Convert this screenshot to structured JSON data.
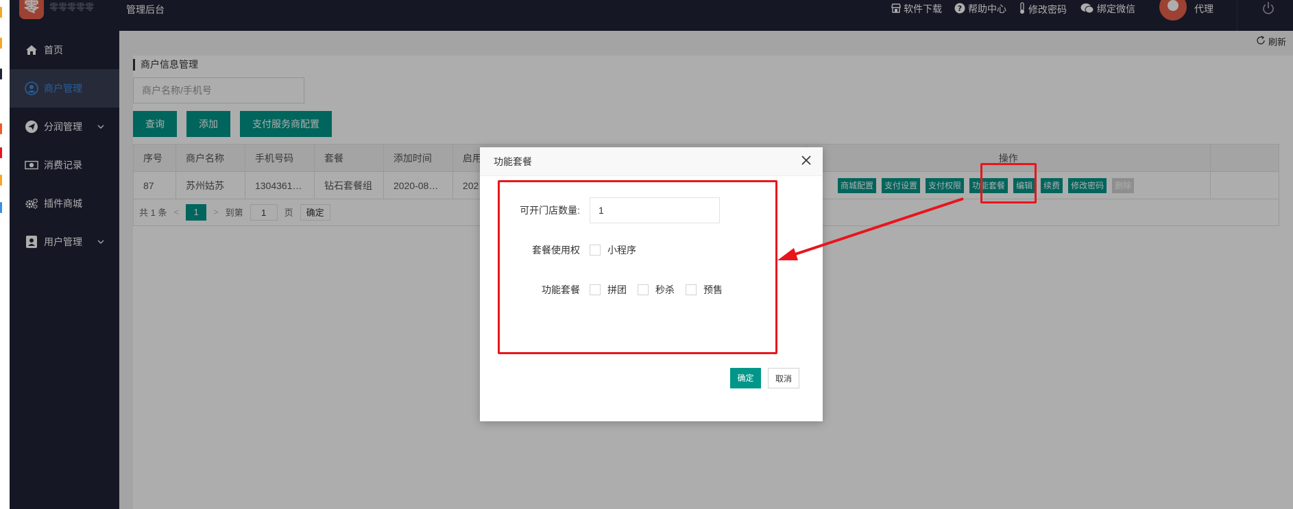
{
  "header": {
    "logo_char": "零",
    "logo_text": "零零零零零",
    "admin_title": "管理后台",
    "nav": [
      {
        "icon": "store-icon",
        "label": "软件下载"
      },
      {
        "icon": "help-icon",
        "label": "帮助中心"
      },
      {
        "icon": "thermometer-icon",
        "label": "修改密码"
      },
      {
        "icon": "wechat-icon",
        "label": "绑定微信"
      }
    ],
    "user_name": "代理"
  },
  "sidebar": {
    "items": [
      {
        "label": "首页",
        "icon": "home-icon",
        "active": false,
        "expandable": false
      },
      {
        "label": "商户管理",
        "icon": "user-circle-icon",
        "active": true,
        "expandable": false
      },
      {
        "label": "分润管理",
        "icon": "send-icon",
        "active": false,
        "expandable": true
      },
      {
        "label": "消费记录",
        "icon": "money-icon",
        "active": false,
        "expandable": false
      },
      {
        "label": "插件商城",
        "icon": "gears-icon",
        "active": false,
        "expandable": false
      },
      {
        "label": "用户管理",
        "icon": "user-card-icon",
        "active": false,
        "expandable": true
      }
    ]
  },
  "main": {
    "refresh_label": "刷新",
    "section_title": "商户信息管理",
    "search_placeholder": "商户名称/手机号",
    "buttons": {
      "query": "查询",
      "add": "添加",
      "pay_config": "支付服务商配置"
    },
    "table": {
      "headers": [
        "序号",
        "商户名称",
        "手机号码",
        "套餐",
        "添加时间",
        "启用",
        "操作"
      ],
      "rows": [
        {
          "id": "87",
          "name": "苏州姑苏",
          "phone": "1304361…",
          "package": "钻石套餐组",
          "added": "2020-08…",
          "enabled": "202"
        }
      ],
      "row_actions": [
        "商城配置",
        "支付设置",
        "支付权限",
        "功能套餐",
        "编辑",
        "续费",
        "修改密码",
        "删除"
      ]
    },
    "pager": {
      "total": "共 1 条",
      "prev": "<",
      "current": "1",
      "next": ">",
      "goto_label": "到第",
      "goto_value": "1",
      "page_unit": "页",
      "confirm": "确定"
    }
  },
  "modal": {
    "title": "功能套餐",
    "store_count_label": "可开门店数量:",
    "store_count_value": "1",
    "usage_label": "套餐使用权",
    "usage_options": [
      "小程序"
    ],
    "features_label": "功能套餐",
    "feature_options": [
      "拼团",
      "秒杀",
      "预售"
    ],
    "ok": "确定",
    "cancel": "取消"
  },
  "colors": {
    "sidebar_bg": "#1f2335",
    "active_item_bg": "#3a3f55",
    "active_text": "#3a8de6",
    "primary_green": "#009688",
    "annotation_red": "#e8151b"
  }
}
